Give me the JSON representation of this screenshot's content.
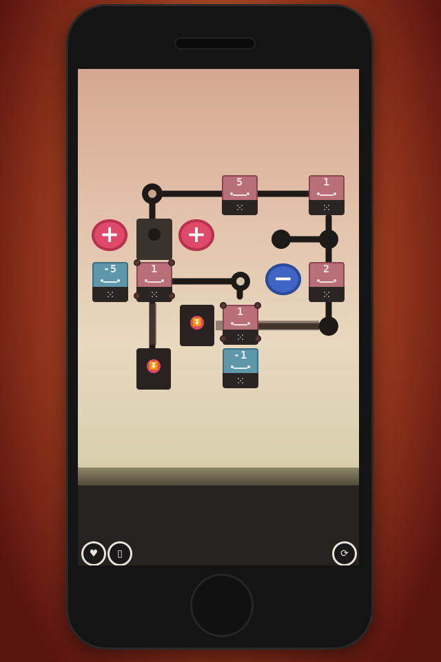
{
  "level": {
    "tiles": [
      {
        "id": "t5",
        "value": "5",
        "color": "pink"
      },
      {
        "id": "t1a",
        "value": "1",
        "color": "pink"
      },
      {
        "id": "tm5",
        "value": "-5",
        "color": "blue"
      },
      {
        "id": "t1b",
        "value": "1",
        "color": "pink"
      },
      {
        "id": "t2",
        "value": "2",
        "color": "pink"
      },
      {
        "id": "t1c",
        "value": "1",
        "color": "pink"
      },
      {
        "id": "tm1",
        "value": "-1",
        "color": "blue"
      }
    ],
    "buttons": {
      "plus": "+",
      "minus": "−",
      "arrow": "⏬"
    }
  },
  "controls": {
    "left_icons": [
      "heart-icon",
      "device-icon"
    ],
    "right_icon": "restart-icon",
    "heart_glyph": "♥",
    "device_glyph": "▯",
    "restart_glyph": "⟳"
  },
  "colors": {
    "pink": "#b86f78",
    "blue": "#5f97aa",
    "red_button": "#e04a6a",
    "blue_button": "#3f64c4"
  }
}
